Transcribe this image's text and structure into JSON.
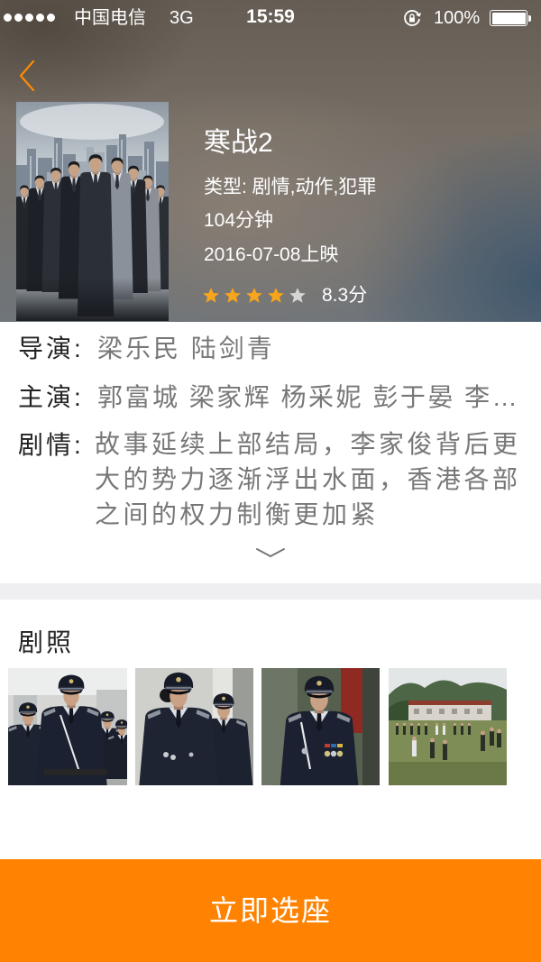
{
  "status_bar": {
    "signal_bars": 5,
    "signal_max": 5,
    "carrier": "中国电信",
    "network": "3G",
    "time": "15:59",
    "battery_text": "100%",
    "battery_level": 1.0,
    "orientation_lock_icon": "orientation-lock-icon"
  },
  "colors": {
    "accent": "#ff8200",
    "back_icon": "#ff8a00",
    "star_on": "#f8a51c",
    "star_off": "#d6d6d6",
    "label": "#222222",
    "value": "#777777"
  },
  "header": {
    "back_icon": "chevron-left-icon",
    "title": "寒战2",
    "genre": "类型: 剧情,动作,犯罪",
    "duration": "104分钟",
    "release": "2016-07-08上映",
    "rating": {
      "stars_filled": 4,
      "stars_total": 5,
      "score": "8.3分"
    }
  },
  "info": {
    "director_label": "导演:",
    "director": "梁乐民 陆剑青",
    "cast_label": "主演:",
    "cast": "郭富城 梁家辉 杨采妮 彭于晏 李…",
    "plot_label": "剧情:",
    "plot": "故事延续上部结局，李家俊背后更大的势力逐渐浮出水面，香港各部之间的权力制衡更加紧",
    "expand_icon": "chevron-down-icon"
  },
  "stills": {
    "title": "剧照"
  },
  "bottom": {
    "button_label": "立即选座"
  }
}
